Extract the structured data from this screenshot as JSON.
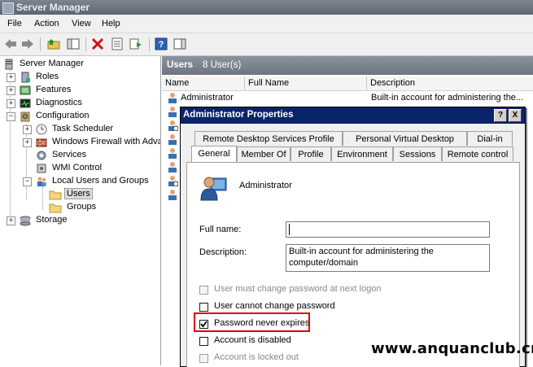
{
  "window": {
    "title": "Server Manager"
  },
  "menu": [
    "File",
    "Action",
    "View",
    "Help"
  ],
  "toolbar": {
    "icons": [
      "back-arrow-icon",
      "forward-arrow-icon",
      "up-folder-icon",
      "show-hide-tree-icon",
      "delete-icon",
      "properties-icon",
      "export-list-icon",
      "help-icon",
      "show-hide-action-pane-icon"
    ]
  },
  "tree": {
    "root": "Server Manager",
    "roles": "Roles",
    "features": "Features",
    "diagnostics": "Diagnostics",
    "configuration": "Configuration",
    "task_scheduler": "Task Scheduler",
    "firewall": "Windows Firewall with Adva",
    "services": "Services",
    "wmi": "WMI Control",
    "local_users": "Local Users and Groups",
    "users": "Users",
    "groups": "Groups",
    "storage": "Storage"
  },
  "pane": {
    "title": "Users",
    "count": "8 User(s)",
    "columns": [
      "Name",
      "Full Name",
      "Description"
    ],
    "first_row": {
      "name": "Administrator",
      "full_name": "",
      "description": "Built-in account for administering the..."
    }
  },
  "dialog": {
    "title": "Administrator Properties",
    "help_button": "?",
    "close_button": "X",
    "tabs_row1": [
      "Remote Desktop Services Profile",
      "Personal Virtual Desktop",
      "Dial-in"
    ],
    "tabs_row2": [
      "General",
      "Member Of",
      "Profile",
      "Environment",
      "Sessions",
      "Remote control"
    ],
    "active_tab": "General",
    "username": "Administrator",
    "full_name_label": "Full name:",
    "full_name_value": "",
    "description_label": "Description:",
    "description_line1": "Built-in account for administering the",
    "description_line2": "computer/domain",
    "checkboxes": [
      {
        "label": "User must change password at next logon",
        "checked": false,
        "disabled": true
      },
      {
        "label": "User cannot change password",
        "checked": false,
        "disabled": false
      },
      {
        "label": "Password never expires",
        "checked": true,
        "disabled": false
      },
      {
        "label": "Account is disabled",
        "checked": false,
        "disabled": false
      },
      {
        "label": "Account is locked out",
        "checked": false,
        "disabled": true
      }
    ],
    "highlight_color": "#e00000"
  },
  "watermark": "www.anquanclub.cn"
}
